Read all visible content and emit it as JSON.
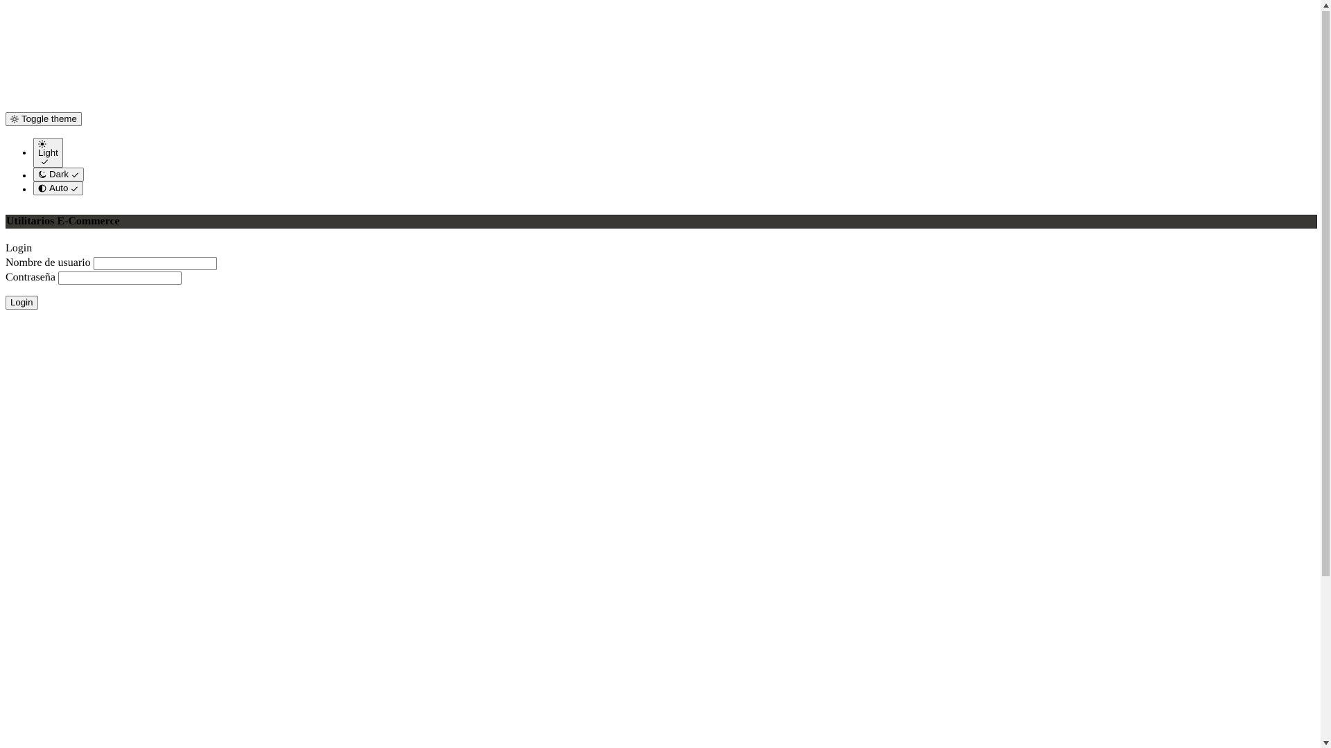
{
  "theme_toggle": {
    "label": "Toggle theme"
  },
  "theme_options": [
    {
      "label": "Light",
      "icon": "sun-icon",
      "selected": true
    },
    {
      "label": "Dark",
      "icon": "moon-stars-icon",
      "selected": false
    },
    {
      "label": "Auto",
      "icon": "circle-half-icon",
      "selected": false
    }
  ],
  "navbar": {
    "brand": "Utilitarios E-Commerce"
  },
  "login": {
    "heading": "Login",
    "username_label": "Nombre de usuario",
    "password_label": "Contraseña",
    "submit_label": "Login"
  },
  "colors": {
    "navbar_bg": "#3a3833"
  }
}
